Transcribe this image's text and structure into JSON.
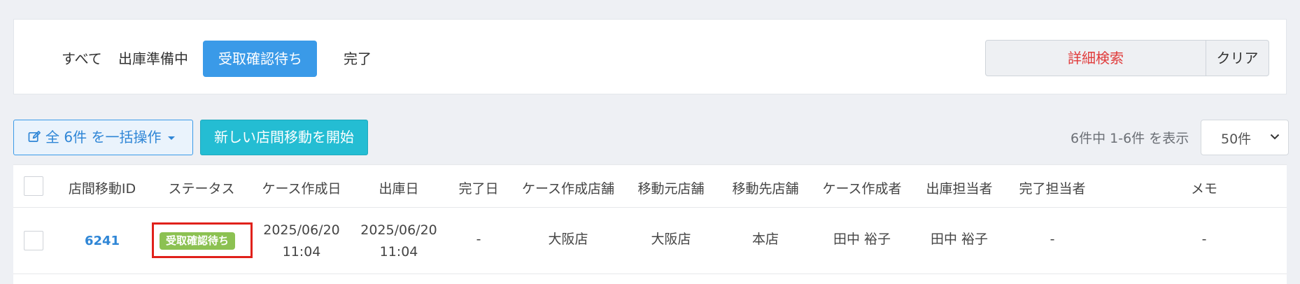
{
  "filter_tabs": [
    "すべて",
    "出庫準備中",
    "受取確認待ち",
    "完了"
  ],
  "active_tab": "受取確認待ち",
  "search": {
    "detail_label": "詳細検索",
    "clear_label": "クリア"
  },
  "toolbar": {
    "bulk_label": "全 6件 を一括操作",
    "new_label": "新しい店間移動を開始",
    "range_text": "6件中 1-6件 を表示",
    "per_page": "50件"
  },
  "table": {
    "headers": [
      "店間移動ID",
      "ステータス",
      "ケース作成日",
      "出庫日",
      "完了日",
      "ケース作成店舗",
      "移動元店舗",
      "移動先店舗",
      "ケース作成者",
      "出庫担当者",
      "完了担当者",
      "メモ"
    ],
    "rows": [
      {
        "id": "6241",
        "status": "受取確認待ち",
        "case_date": "2025/06/20",
        "case_time": "11:04",
        "ship_date": "2025/06/20",
        "ship_time": "11:04",
        "done_date": "-",
        "case_store": "大阪店",
        "from_store": "大阪店",
        "to_store": "本店",
        "case_creator": "田中 裕子",
        "shipper": "田中 裕子",
        "completer": "-",
        "memo": "-"
      }
    ]
  },
  "colors": {
    "accent": "#3a9ae8",
    "new_button": "#24bdd3",
    "status_badge": "#8cc152",
    "detail_search_text": "#e03a3a",
    "highlight_box": "#e0211b"
  },
  "icons": [
    "edit-icon",
    "caret-down-icon",
    "chevron-down-icon"
  ]
}
